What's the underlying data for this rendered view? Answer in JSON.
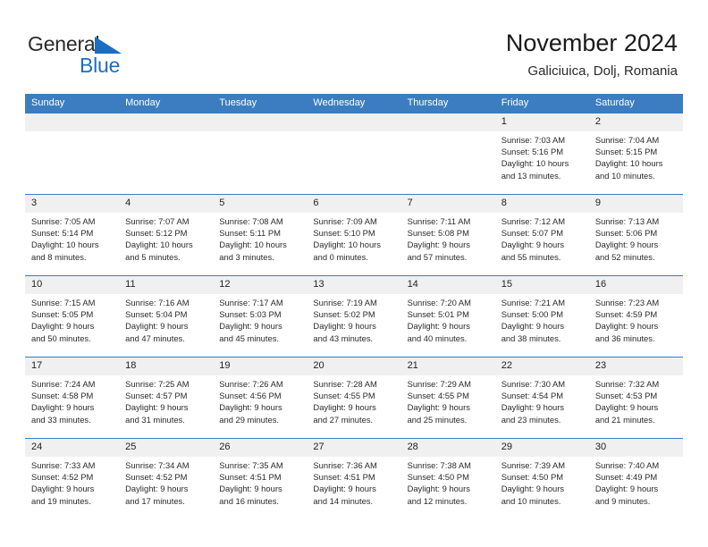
{
  "brand": {
    "name_part1": "General",
    "name_part2": "Blue",
    "accent_color": "#1b6ec2"
  },
  "header": {
    "title": "November 2024",
    "subtitle": "Galiciuica, Dolj, Romania"
  },
  "theme": {
    "header_bg": "#3b7dc0",
    "daynum_bg": "#f0f0f0",
    "cell_bg": "#ffffff",
    "text": "#2a2a2a"
  },
  "weekday_headers": [
    "Sunday",
    "Monday",
    "Tuesday",
    "Wednesday",
    "Thursday",
    "Friday",
    "Saturday"
  ],
  "labels": {
    "sunrise": "Sunrise:",
    "sunset": "Sunset:",
    "daylight": "Daylight:"
  },
  "weeks": [
    [
      {
        "day": "",
        "lines": []
      },
      {
        "day": "",
        "lines": []
      },
      {
        "day": "",
        "lines": []
      },
      {
        "day": "",
        "lines": []
      },
      {
        "day": "",
        "lines": []
      },
      {
        "day": "1",
        "lines": [
          "Sunrise: 7:03 AM",
          "Sunset: 5:16 PM",
          "Daylight: 10 hours",
          "and 13 minutes."
        ]
      },
      {
        "day": "2",
        "lines": [
          "Sunrise: 7:04 AM",
          "Sunset: 5:15 PM",
          "Daylight: 10 hours",
          "and 10 minutes."
        ]
      }
    ],
    [
      {
        "day": "3",
        "lines": [
          "Sunrise: 7:05 AM",
          "Sunset: 5:14 PM",
          "Daylight: 10 hours",
          "and 8 minutes."
        ]
      },
      {
        "day": "4",
        "lines": [
          "Sunrise: 7:07 AM",
          "Sunset: 5:12 PM",
          "Daylight: 10 hours",
          "and 5 minutes."
        ]
      },
      {
        "day": "5",
        "lines": [
          "Sunrise: 7:08 AM",
          "Sunset: 5:11 PM",
          "Daylight: 10 hours",
          "and 3 minutes."
        ]
      },
      {
        "day": "6",
        "lines": [
          "Sunrise: 7:09 AM",
          "Sunset: 5:10 PM",
          "Daylight: 10 hours",
          "and 0 minutes."
        ]
      },
      {
        "day": "7",
        "lines": [
          "Sunrise: 7:11 AM",
          "Sunset: 5:08 PM",
          "Daylight: 9 hours",
          "and 57 minutes."
        ]
      },
      {
        "day": "8",
        "lines": [
          "Sunrise: 7:12 AM",
          "Sunset: 5:07 PM",
          "Daylight: 9 hours",
          "and 55 minutes."
        ]
      },
      {
        "day": "9",
        "lines": [
          "Sunrise: 7:13 AM",
          "Sunset: 5:06 PM",
          "Daylight: 9 hours",
          "and 52 minutes."
        ]
      }
    ],
    [
      {
        "day": "10",
        "lines": [
          "Sunrise: 7:15 AM",
          "Sunset: 5:05 PM",
          "Daylight: 9 hours",
          "and 50 minutes."
        ]
      },
      {
        "day": "11",
        "lines": [
          "Sunrise: 7:16 AM",
          "Sunset: 5:04 PM",
          "Daylight: 9 hours",
          "and 47 minutes."
        ]
      },
      {
        "day": "12",
        "lines": [
          "Sunrise: 7:17 AM",
          "Sunset: 5:03 PM",
          "Daylight: 9 hours",
          "and 45 minutes."
        ]
      },
      {
        "day": "13",
        "lines": [
          "Sunrise: 7:19 AM",
          "Sunset: 5:02 PM",
          "Daylight: 9 hours",
          "and 43 minutes."
        ]
      },
      {
        "day": "14",
        "lines": [
          "Sunrise: 7:20 AM",
          "Sunset: 5:01 PM",
          "Daylight: 9 hours",
          "and 40 minutes."
        ]
      },
      {
        "day": "15",
        "lines": [
          "Sunrise: 7:21 AM",
          "Sunset: 5:00 PM",
          "Daylight: 9 hours",
          "and 38 minutes."
        ]
      },
      {
        "day": "16",
        "lines": [
          "Sunrise: 7:23 AM",
          "Sunset: 4:59 PM",
          "Daylight: 9 hours",
          "and 36 minutes."
        ]
      }
    ],
    [
      {
        "day": "17",
        "lines": [
          "Sunrise: 7:24 AM",
          "Sunset: 4:58 PM",
          "Daylight: 9 hours",
          "and 33 minutes."
        ]
      },
      {
        "day": "18",
        "lines": [
          "Sunrise: 7:25 AM",
          "Sunset: 4:57 PM",
          "Daylight: 9 hours",
          "and 31 minutes."
        ]
      },
      {
        "day": "19",
        "lines": [
          "Sunrise: 7:26 AM",
          "Sunset: 4:56 PM",
          "Daylight: 9 hours",
          "and 29 minutes."
        ]
      },
      {
        "day": "20",
        "lines": [
          "Sunrise: 7:28 AM",
          "Sunset: 4:55 PM",
          "Daylight: 9 hours",
          "and 27 minutes."
        ]
      },
      {
        "day": "21",
        "lines": [
          "Sunrise: 7:29 AM",
          "Sunset: 4:55 PM",
          "Daylight: 9 hours",
          "and 25 minutes."
        ]
      },
      {
        "day": "22",
        "lines": [
          "Sunrise: 7:30 AM",
          "Sunset: 4:54 PM",
          "Daylight: 9 hours",
          "and 23 minutes."
        ]
      },
      {
        "day": "23",
        "lines": [
          "Sunrise: 7:32 AM",
          "Sunset: 4:53 PM",
          "Daylight: 9 hours",
          "and 21 minutes."
        ]
      }
    ],
    [
      {
        "day": "24",
        "lines": [
          "Sunrise: 7:33 AM",
          "Sunset: 4:52 PM",
          "Daylight: 9 hours",
          "and 19 minutes."
        ]
      },
      {
        "day": "25",
        "lines": [
          "Sunrise: 7:34 AM",
          "Sunset: 4:52 PM",
          "Daylight: 9 hours",
          "and 17 minutes."
        ]
      },
      {
        "day": "26",
        "lines": [
          "Sunrise: 7:35 AM",
          "Sunset: 4:51 PM",
          "Daylight: 9 hours",
          "and 16 minutes."
        ]
      },
      {
        "day": "27",
        "lines": [
          "Sunrise: 7:36 AM",
          "Sunset: 4:51 PM",
          "Daylight: 9 hours",
          "and 14 minutes."
        ]
      },
      {
        "day": "28",
        "lines": [
          "Sunrise: 7:38 AM",
          "Sunset: 4:50 PM",
          "Daylight: 9 hours",
          "and 12 minutes."
        ]
      },
      {
        "day": "29",
        "lines": [
          "Sunrise: 7:39 AM",
          "Sunset: 4:50 PM",
          "Daylight: 9 hours",
          "and 10 minutes."
        ]
      },
      {
        "day": "30",
        "lines": [
          "Sunrise: 7:40 AM",
          "Sunset: 4:49 PM",
          "Daylight: 9 hours",
          "and 9 minutes."
        ]
      }
    ]
  ]
}
